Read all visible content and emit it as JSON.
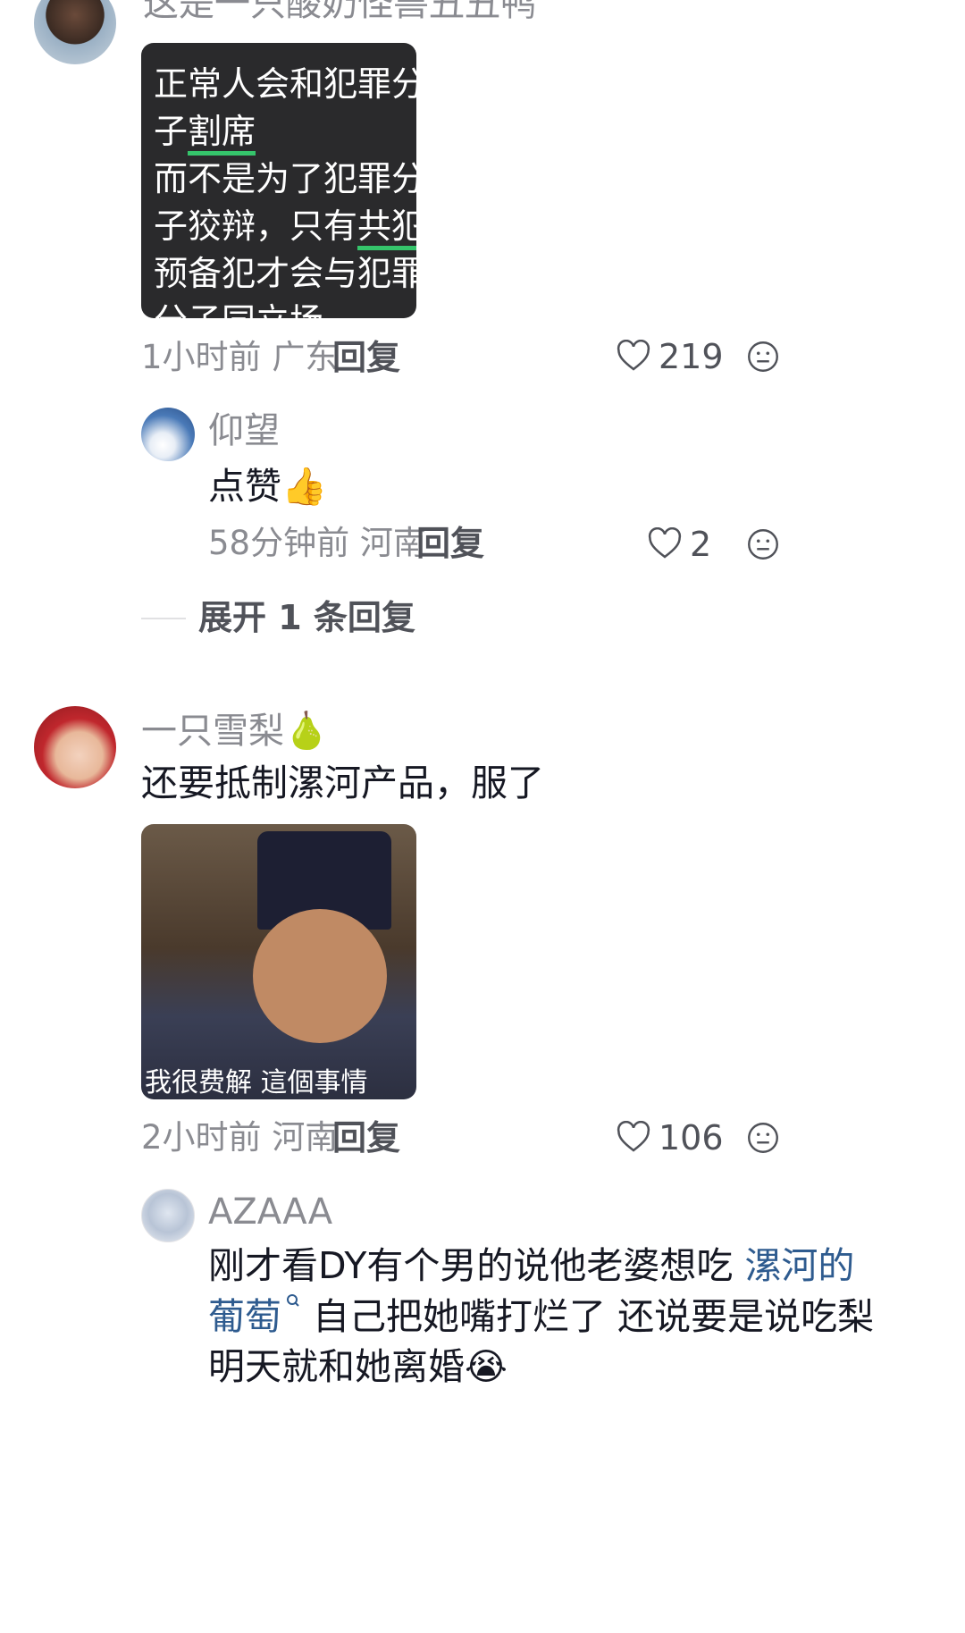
{
  "comments": [
    {
      "username": "这是一只酸奶怪兽丑丑鸭",
      "sticker_lines": [
        [
          {
            "t": "正常人会和犯罪分",
            "hl": false
          }
        ],
        [
          {
            "t": "子",
            "hl": false
          },
          {
            "t": "割席",
            "hl": true
          }
        ],
        [
          {
            "t": "而不是为了犯罪分",
            "hl": false
          }
        ],
        [
          {
            "t": "子狡辩，只有",
            "hl": false
          },
          {
            "t": "共犯",
            "hl": true
          },
          {
            "t": "、",
            "hl": false
          }
        ],
        [
          {
            "t": "预备犯才会与犯罪",
            "hl": false
          }
        ],
        [
          {
            "t": "分子同立场",
            "hl": false
          }
        ]
      ],
      "time": "1小时前",
      "location": "广东",
      "reply_label": "回复",
      "likes": "219"
    },
    {
      "username": "仰望",
      "text": "点赞",
      "emoji": "👍",
      "time": "58分钟前",
      "location": "河南",
      "reply_label": "回复",
      "likes": "2"
    },
    {
      "username": "一只雪梨",
      "username_emoji": "🍐",
      "text": "还要抵制漯河产品，服了",
      "image_caption": "我很费解 這個事情",
      "time": "2小时前",
      "location": "河南",
      "reply_label": "回复",
      "likes": "106"
    },
    {
      "username": "AZAAA",
      "text_line1_a": "刚才看DY有个男的说他老婆想吃",
      "text_line1_link": "漯河的",
      "text_line2_link": "葡萄",
      "text_line2_b": "自己把她嘴打烂了 还说要是说吃梨",
      "text_line3": "明天就和她离婚",
      "emoji": "😭"
    }
  ],
  "expand_replies": "展开 1 条回复",
  "colors": {
    "highlight": "#35c46b",
    "link": "#2e5b8f",
    "meta": "#8a8b91"
  }
}
